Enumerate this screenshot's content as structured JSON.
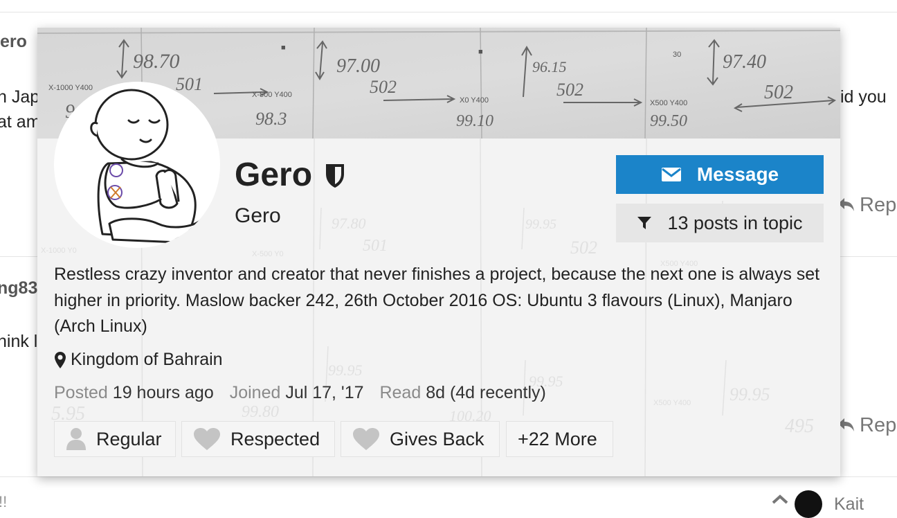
{
  "background": {
    "post1": {
      "username_fragment": "ero",
      "line1_left": "n Jap",
      "line2_left": "at am",
      "line1_right": "id you",
      "reply_label": "Rep"
    },
    "post2": {
      "username_fragment": "ng83",
      "line1_left": "hink l",
      "reply_label": "Rep"
    },
    "post3": {
      "username_fragment": "Kait"
    }
  },
  "user_card": {
    "username": "Gero",
    "name": "Gero",
    "message_button": "Message",
    "posts_in_topic_button": "13 posts in topic",
    "bio": "Restless crazy inventor and creator that never finishes a project, because the next one is always set higher in priority. Maslow backer 242, 26th October 2016 OS: Ubuntu 3 flavours (Linux), Manjaro (Arch Linux)",
    "location": "Kingdom of Bahrain",
    "meta": {
      "posted_label": "Posted",
      "posted_value": "19 hours ago",
      "joined_label": "Joined",
      "joined_value": "Jul 17, '17",
      "read_label": "Read",
      "read_value": "8d (4d recently)"
    },
    "badges": [
      {
        "label": "Regular",
        "icon": "user-icon"
      },
      {
        "label": "Respected",
        "icon": "heart-icon"
      },
      {
        "label": "Gives Back",
        "icon": "heart-icon"
      },
      {
        "label": "+22 More",
        "icon": ""
      }
    ],
    "background_photo_text": {
      "top": [
        "98.70",
        "501",
        "97.00",
        "502",
        "96.15",
        "502",
        "97.40",
        "502",
        "X-1000 Y400",
        "X-500 Y400",
        "X0 Y400",
        "X500 Y400",
        "98.3",
        "99.10",
        "99.50",
        "9"
      ],
      "faded": [
        "97.80",
        "501",
        "99.95",
        "502",
        "X-1000 Y0",
        "X-500 Y0",
        "X500 Y400",
        "X500 Y400",
        "99.95",
        "99.80",
        "100.20",
        "100.25",
        "495",
        "5.95"
      ]
    },
    "colors": {
      "message_button": "#1b84c9",
      "card_background": "#f4f4f4"
    }
  }
}
